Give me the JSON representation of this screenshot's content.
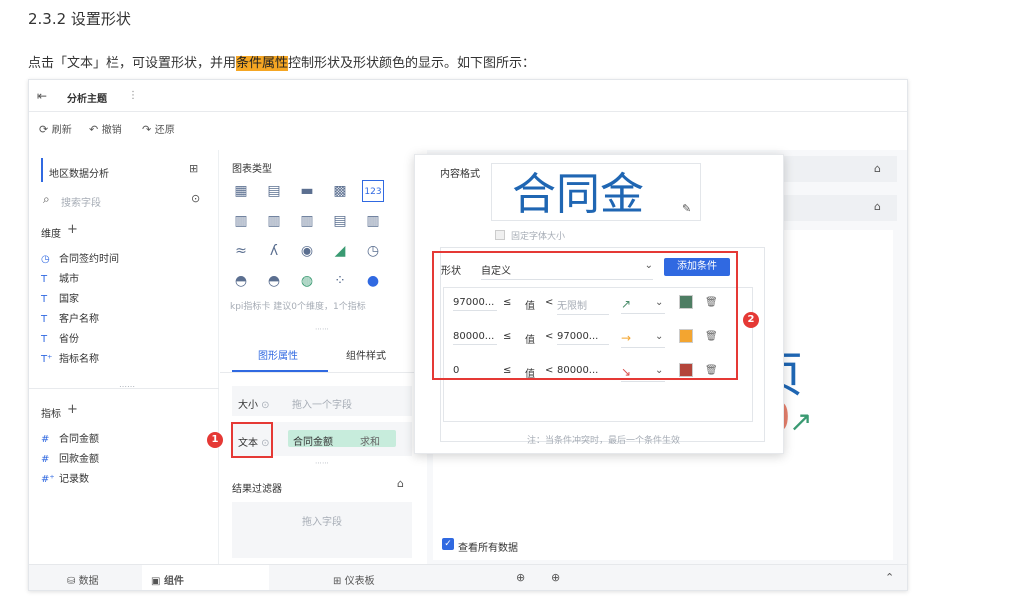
{
  "doc": {
    "heading": "2.3.2 设置形状",
    "para_before": "点击「文本」栏，可设置形状，并用",
    "para_highlight": "条件属性",
    "para_after": "控制形状及形状颜色的显示。如下图所示："
  },
  "topbar": {
    "title": "分析主题",
    "more": "⋮"
  },
  "toolbar": {
    "refresh": "刷新",
    "undo": "撤销",
    "redo": "还原"
  },
  "left": {
    "dataset": "地区数据分析",
    "search_placeholder": "搜索字段",
    "dim_title": "维度",
    "dimensions": [
      {
        "icon": "◷",
        "label": "合同签约时间"
      },
      {
        "icon": "T",
        "label": "城市"
      },
      {
        "icon": "T",
        "label": "国家"
      },
      {
        "icon": "T",
        "label": "客户名称"
      },
      {
        "icon": "T",
        "label": "省份"
      },
      {
        "icon": "T⁺",
        "label": "指标名称"
      }
    ],
    "dots": "⋯⋯",
    "metric_title": "指标",
    "metrics": [
      {
        "icon": "#",
        "label": "合同金额"
      },
      {
        "icon": "#",
        "label": "回款金额"
      },
      {
        "icon": "#⁺",
        "label": "记录数"
      }
    ]
  },
  "middle": {
    "chart_type_title": "图表类型",
    "kpi_hint": "kpi指标卡 建议0个维度，1个指标",
    "tab_graph": "图形属性",
    "tab_style": "组件样式",
    "size_label": "大小",
    "size_drop": "拖入一个字段",
    "text_label": "文本",
    "text_field": "合同金额",
    "text_agg": "求和",
    "filter_title": "结果过滤器",
    "filter_drop": "拖入字段"
  },
  "popup": {
    "content_format": "内容格式",
    "preview_text": "合同金",
    "fixed_font": "固定字体大小",
    "shape_label": "形状",
    "shape_value": "自定义",
    "add_condition": "添加条件",
    "val_label": "值",
    "rows": [
      {
        "from": "97000...",
        "to": "无限制",
        "to_is_placeholder": true,
        "arrow": "↗",
        "arrow_color": "#4a8c6a",
        "color": "#4e7d63"
      },
      {
        "from": "80000...",
        "to": "97000...",
        "to_is_placeholder": false,
        "arrow": "→",
        "arrow_color": "#f3a530",
        "color": "#f3a530"
      },
      {
        "from": "0",
        "to": "80000...",
        "to_is_placeholder": false,
        "arrow": "↘",
        "arrow_color": "#d9534f",
        "color": "#b3453a"
      }
    ],
    "note": "注：当条件冲突时，最后一个条件生效"
  },
  "canvas": {
    "big_glyph": "页",
    "number_fragment": "0",
    "view_all": "查看所有数据"
  },
  "bottom": {
    "data": "数据",
    "component": "组件",
    "dashboard": "仪表板"
  },
  "badges": {
    "one": "1",
    "two": "2"
  },
  "colors": {
    "blue": "#3069e1",
    "red": "#e53935",
    "highlight": "#f5a623",
    "kpi_blue": "#1f66b3"
  }
}
